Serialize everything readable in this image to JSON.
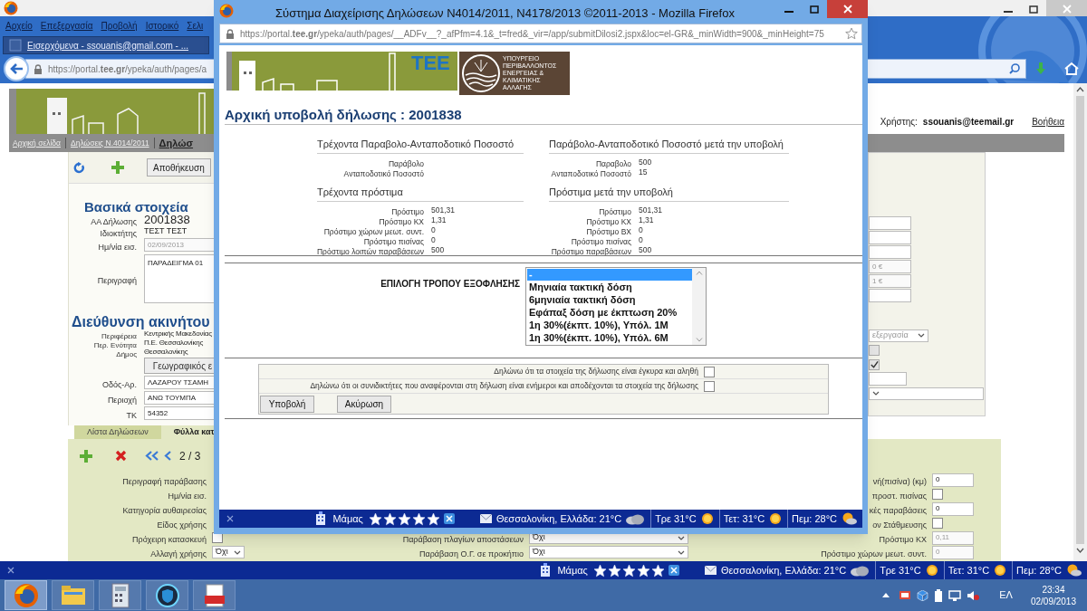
{
  "window": {
    "menu": [
      {
        "label": "Αρχείο"
      },
      {
        "label": "Επεξεργασία"
      },
      {
        "label": "Προβολή"
      },
      {
        "label": "Ιστορικό"
      },
      {
        "label": "Σελι"
      }
    ],
    "tab": {
      "title": "Εισερχόμενα - ssouanis@gmail.com - ..."
    },
    "address": "https://portal.**tee.gr**/ypeka/auth/pages/a"
  },
  "page": {
    "nav": [
      {
        "label": "Αρχική σελίδα",
        "selected": false
      },
      {
        "label": "Δηλώσεις Ν.4014/2011",
        "selected": false
      },
      {
        "label": "Δηλώσ",
        "selected": true
      }
    ],
    "user_label": "Χρήστης:",
    "user": "ssouanis@teemail.gr",
    "help": "Βοήθεια",
    "save_button": "Αποθήκευση",
    "basic": {
      "title": "Βασικά στοιχεία",
      "fields": [
        {
          "label": "ΑΑ Δήλωσης",
          "kind": "strong",
          "value": "2001838"
        },
        {
          "label": "Ιδιοκτήτης",
          "kind": "text",
          "value": "ΤΕΣΤ ΤΕΣΤ"
        },
        {
          "label": "Ημ/νία εισ.",
          "kind": "input",
          "value": "02/09/2013",
          "disabled": true
        },
        {
          "label": "Περιγραφή",
          "kind": "textarea",
          "value": "ΠΑΡΑΔΕΙΓΜΑ 01",
          "disabled": false
        }
      ]
    },
    "address_section": {
      "title": "Διεύθυνση ακινήτου",
      "fields": [
        {
          "label": "Περιφέρεια",
          "kind": "small",
          "value": "Κεντρικής Μακεδονίας"
        },
        {
          "label": "Περ. Ενότητα",
          "kind": "small",
          "value": "Π.Ε. Θεσσαλονίκης"
        },
        {
          "label": "Δήμος",
          "kind": "small",
          "value": "Θεσσαλονίκης"
        },
        {
          "kind": "button",
          "value": "Γεωγραφικός ε"
        },
        {
          "label": "Οδός-Αρ.",
          "kind": "input",
          "value": "ΛΑΖΑΡΟΥ ΤΣΑΜΗ",
          "disabled": false
        },
        {
          "label": "Περιοχή",
          "kind": "input",
          "value": "ΑΝΩ ΤΟΥΜΠΑ",
          "disabled": false
        },
        {
          "label": "ΤΚ",
          "kind": "input",
          "value": "54352",
          "disabled": false
        }
      ]
    },
    "right_fields": [
      {
        "kind": "input"
      },
      {
        "kind": "input"
      },
      {
        "kind": "input"
      },
      {
        "kind": "input",
        "value": "0 €",
        "disabled": true
      },
      {
        "kind": "input",
        "value": "1 €",
        "disabled": true
      },
      {
        "kind": "input"
      },
      {
        "kind": "select",
        "value": "εξεργασία",
        "disabled": true
      },
      {
        "kind": "checkbox",
        "checked": false,
        "disabled": true
      },
      {
        "kind": "checkbox",
        "checked": true,
        "disabled": true
      },
      {
        "kind": "input"
      },
      {
        "kind": "select"
      }
    ],
    "tabs": [
      {
        "label": "Λίστα Δηλώσεων",
        "selected": false
      },
      {
        "label": "Φύλλα κατ",
        "selected": true
      }
    ],
    "pager": "2 / 3",
    "violation_fields": [
      {
        "label": "Περιγραφή παράβασης"
      },
      {
        "label": "Ημ/νία εισ."
      },
      {
        "label": "Κατηγορία αυθαιρεσίας"
      },
      {
        "label": "Είδος χρήσης"
      },
      {
        "label": "Πρόχειρη κατασκευή",
        "kind": "checkbox",
        "checked": false,
        "disabled": false
      },
      {
        "label": "Αλλαγή χρήσης",
        "kind": "select",
        "value": "Όχι",
        "disabled": false
      }
    ],
    "middle_fields": [
      {
        "label": "Παράβαση πλαγίων αποστάσεων",
        "kind": "select",
        "value": "Όχι",
        "disabled": false
      },
      {
        "label": "Παράβαση Ο.Γ. σε προκήπιο",
        "kind": "select",
        "value": "Όχι",
        "disabled": false
      }
    ],
    "right_violation_fields": [
      {
        "label": "νή(πισίνα) (κμ)",
        "kind": "input",
        "value": "0",
        "disabled": false
      },
      {
        "label": "προστ. πισίνας",
        "kind": "checkbox",
        "checked": false,
        "disabled": false
      },
      {
        "label": "κές παραβάσεις",
        "kind": "input",
        "value": "0",
        "disabled": false
      },
      {
        "label": "ον Στάθμευσης",
        "kind": "checkbox",
        "checked": false,
        "disabled": false
      },
      {
        "label": "Πρόστιμο ΚΧ",
        "kind": "input",
        "value": "0,11",
        "disabled": true
      },
      {
        "label": "Πρόστιμο χώρων μεωτ. συντ.",
        "kind": "input",
        "value": "0",
        "disabled": true
      }
    ]
  },
  "popup": {
    "title": "Σύστημα Διαχείρισης Δηλώσεων Ν4014/2011, Ν4178/2013 ©2011-2013 - Mozilla Firefox",
    "address": "https://portal.**tee.gr**/ypeka/auth/pages/__ADFv__?_afPfm=4.1&_t=fred&_vir=/app/submitDilosi2.jspx&loc=el-GR&_minWidth=900&_minHeight=75",
    "logo_text": "ΤΕΕ",
    "ministry_text": "ΥΠΟΥΡΓΕΙΟ\nΠΕΡΙΒΑΛΛΟΝΤΟΣ\nΕΝΕΡΓΕΙΑΣ &\nΚΛΙΜΑΤΙΚΗΣ\nΑΛΛΑΓΗΣ",
    "heading": "Αρχική υποβολή δήλωσης : 2001838",
    "sections": [
      {
        "title": "Τρέχοντα Παραβολο-Ανταποδοτικό Ποσοστό",
        "rows": [
          {
            "label": "Παράβολο"
          },
          {
            "label": "Ανταποδοτικό Ποσοστό"
          }
        ]
      },
      {
        "title": "Παράβολο-Ανταποδοτικό Ποσοστό μετά την υποβολή",
        "rows": [
          {
            "label": "Παραβολο",
            "value": "500"
          },
          {
            "label": "Ανταποδοτικό Ποσοστό",
            "value": "15"
          }
        ]
      },
      {
        "title": "Τρέχοντα πρόστιμα",
        "rows": [
          {
            "label": "Πρόστιμο",
            "value": "501,31"
          },
          {
            "label": "Πρόστιμο ΚΧ",
            "value": "1,31"
          },
          {
            "label": "Πρόστιμο χώρων μεωτ. συντ.",
            "value": "0"
          },
          {
            "label": "Πρόστιμο πισίνας",
            "value": "0"
          },
          {
            "label": "Πρόστιμο λοιπών παραβάσεων",
            "value": "500"
          }
        ]
      },
      {
        "title": "Πρόστιμα μετά την υποβολή",
        "rows": [
          {
            "label": "Πρόστιμο",
            "value": "501,31"
          },
          {
            "label": "Πρόστιμο ΚΧ",
            "value": "1,31"
          },
          {
            "label": "Πρόστιμο ΒΧ",
            "value": "0"
          },
          {
            "label": "Πρόστιμο πισίνας",
            "value": "0"
          },
          {
            "label": "Πρόστιμο παραβάσεων",
            "value": "500"
          }
        ]
      }
    ],
    "payment_label": "ΕΠΙΛΟΓΗ ΤΡΟΠΟΥ ΕΞΟΦΛΗΣΗΣ",
    "payment_options": [
      {
        "label": "-",
        "selected": true
      },
      {
        "label": "Μηνιαία τακτική δόση",
        "selected": false
      },
      {
        "label": "6μηνιαία τακτική δόση",
        "selected": false
      },
      {
        "label": "Εφάπαξ δόση με έκπτωση 20%",
        "selected": false
      },
      {
        "label": "1η 30%(έκπτ. 10%), Υπόλ. 1Μ",
        "selected": false
      },
      {
        "label": "1η 30%(έκπτ. 10%), Υπόλ. 6Μ",
        "selected": false
      }
    ],
    "declarations": [
      {
        "label": "Δηλώνω ότι τα στοιχεία της δήλωσης είναι έγκυρα και αληθή",
        "checked": false
      },
      {
        "label": "Δηλώνω ότι οι συνιδικτήτες που αναφέρονται στη δήλωση είναι ενήμεροι και αποδέχονται τα στοιχεία της δήλωσης",
        "checked": false
      }
    ],
    "buttons": [
      "Υποβολή",
      "Ακύρωση"
    ],
    "weather_bar": {
      "contact": "Μάμας",
      "stars": 5,
      "location": "Θεσσαλονίκη, Ελλάδα: 21°C",
      "forecast": [
        {
          "label": "Τρε 31°C",
          "kind": "sun"
        },
        {
          "label": "Τετ: 31°C",
          "kind": "sun"
        },
        {
          "label": "Πεμ: 28°C",
          "kind": "sun-cloud"
        }
      ]
    }
  },
  "weather_bar": {
    "contact": "Μάμας",
    "stars": 5,
    "location": "Θεσσαλονίκη, Ελλάδα: 21°C",
    "forecast": [
      {
        "label": "Τρε 31°C",
        "kind": "sun"
      },
      {
        "label": "Τετ: 31°C",
        "kind": "sun"
      },
      {
        "label": "Πεμ: 28°C",
        "kind": "sun-cloud"
      }
    ]
  },
  "taskbar": {
    "apps": [
      {
        "kind": "browser",
        "selected": true
      },
      {
        "kind": "folder",
        "selected": false
      },
      {
        "kind": "calculator",
        "selected": false
      },
      {
        "kind": "shield",
        "selected": false
      },
      {
        "kind": "pdf",
        "selected": false
      }
    ],
    "language": "ΕΛ",
    "time": "23:34",
    "date": "02/09/2013"
  }
}
